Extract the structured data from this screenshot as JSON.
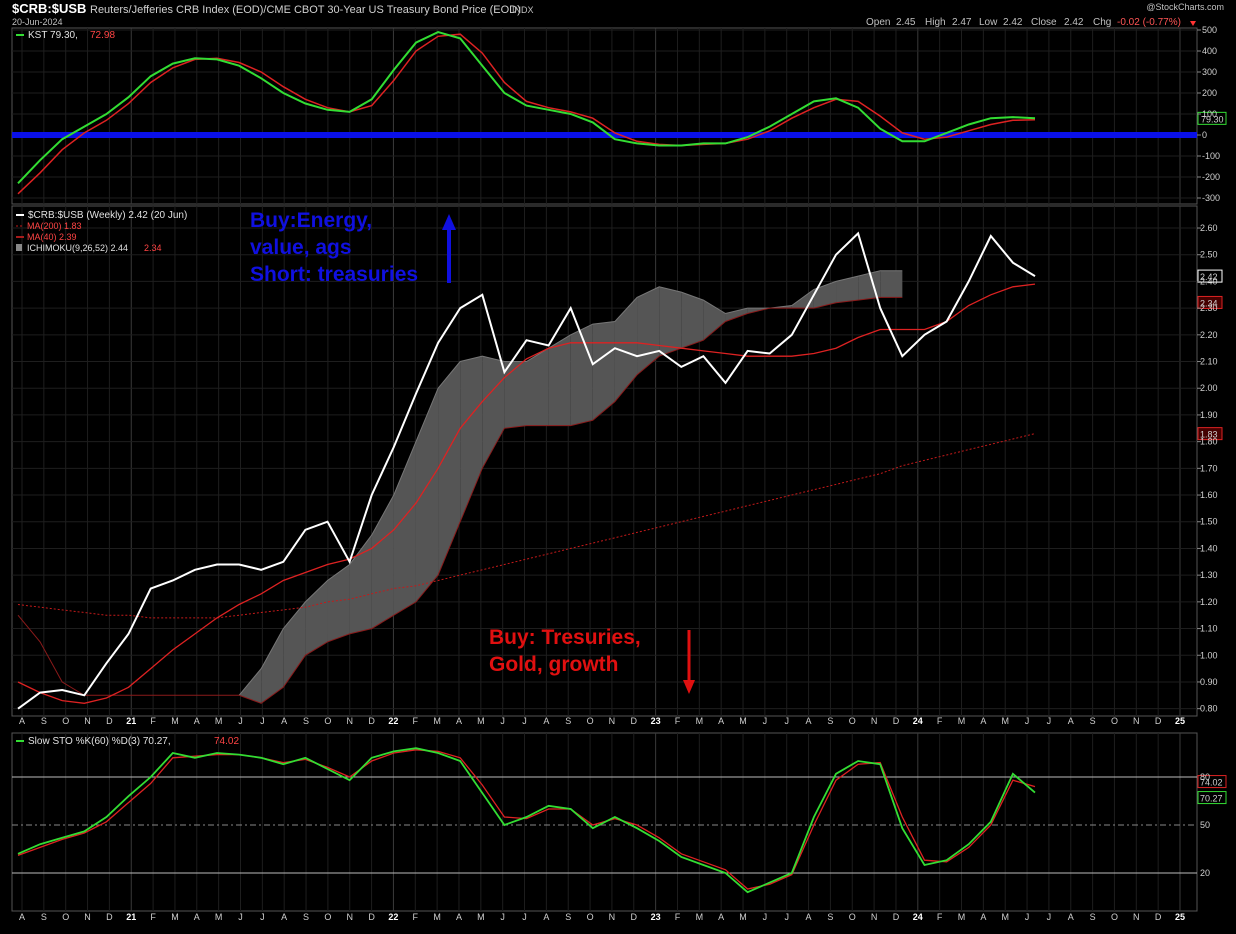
{
  "header": {
    "symbol": "$CRB:$USB",
    "description": "Reuters/Jefferies CRB Index (EOD)/CME CBOT 30-Year US Treasury Bond Price (EOD)",
    "exchange": "INDX",
    "date": "20-Jun-2024",
    "watermark": "@StockCharts.com",
    "open_label": "Open",
    "open": "2.45",
    "high_label": "High",
    "high": "2.47",
    "low_label": "Low",
    "low": "2.42",
    "close_label": "Close",
    "close": "2.42",
    "chg_label": "Chg",
    "chg": "-0.02 (-0.77%)"
  },
  "colors": {
    "background": "#000000",
    "price_line": "#ffffff",
    "kst_line": "#33dd33",
    "signal_line": "#dd2222",
    "zero_line": "#0a10e8",
    "cloud_bull": "#555555",
    "cloud_bear": "#5a0a0a",
    "annotation_blue": "#1010e0",
    "annotation_red": "#e01010"
  },
  "annotations": {
    "buy_energy": [
      "Buy:Energy,",
      "value, ags",
      "Short: treasuries"
    ],
    "buy_treasuries": [
      "Buy: Tresuries,",
      "Gold, growth"
    ]
  },
  "chart_data": [
    {
      "type": "line",
      "panel": "KST",
      "legend": [
        "KST 79.30,",
        "72.98"
      ],
      "last_labels": {
        "kst": "79.30"
      },
      "ylim": [
        -300,
        500
      ],
      "y_ticks": [
        "500",
        "400",
        "300",
        "200",
        "100",
        "0",
        "-100",
        "-200",
        "-300"
      ],
      "x": [
        "2020-08",
        "2020-09",
        "2020-10",
        "2020-11",
        "2020-12",
        "2021-01",
        "2021-02",
        "2021-03",
        "2021-04",
        "2021-05",
        "2021-06",
        "2021-07",
        "2021-08",
        "2021-09",
        "2021-10",
        "2021-11",
        "2021-12",
        "2022-01",
        "2022-02",
        "2022-03",
        "2022-04",
        "2022-05",
        "2022-06",
        "2022-07",
        "2022-08",
        "2022-09",
        "2022-10",
        "2022-11",
        "2022-12",
        "2023-01",
        "2023-02",
        "2023-03",
        "2023-04",
        "2023-05",
        "2023-06",
        "2023-07",
        "2023-08",
        "2023-09",
        "2023-10",
        "2023-11",
        "2023-12",
        "2024-01",
        "2024-02",
        "2024-03",
        "2024-04",
        "2024-05",
        "2024-06"
      ],
      "series": [
        {
          "name": "KST",
          "color": "#33dd33",
          "values": [
            -230,
            -120,
            -20,
            40,
            100,
            180,
            280,
            340,
            365,
            360,
            330,
            270,
            200,
            150,
            120,
            110,
            170,
            310,
            440,
            490,
            460,
            330,
            200,
            140,
            120,
            100,
            60,
            -20,
            -40,
            -50,
            -50,
            -40,
            -40,
            -10,
            40,
            100,
            160,
            175,
            130,
            30,
            -30,
            -30,
            10,
            50,
            80,
            85,
            79.3
          ]
        },
        {
          "name": "Signal",
          "color": "#dd2222",
          "values": [
            -280,
            -180,
            -70,
            10,
            70,
            150,
            250,
            320,
            360,
            365,
            345,
            300,
            230,
            170,
            130,
            110,
            140,
            260,
            400,
            470,
            480,
            390,
            250,
            160,
            130,
            110,
            80,
            10,
            -30,
            -45,
            -50,
            -45,
            -40,
            -20,
            20,
            80,
            130,
            170,
            160,
            90,
            10,
            -20,
            -10,
            20,
            50,
            70,
            72.98
          ]
        }
      ],
      "zero_line": 0
    },
    {
      "type": "line",
      "panel": "Price",
      "legend": [
        "$CRB:$USB (Weekly) 2.42 (20 Jun)",
        "MA(200) 1.83",
        "MA(40) 2.39",
        "ICHIMOKU(9,26,52) 2.44",
        "2.34"
      ],
      "last_labels": {
        "price": "2.42",
        "ichimoku": "2.44",
        "cloud": "2.34",
        "ma200": "1.83"
      },
      "ylim": [
        0.78,
        2.66
      ],
      "y_ticks": [
        "2.60",
        "2.50",
        "2.40",
        "2.30",
        "2.20",
        "2.10",
        "2.00",
        "1.90",
        "1.80",
        "1.70",
        "1.60",
        "1.50",
        "1.40",
        "1.30",
        "1.20",
        "1.10",
        "1.00",
        "0.90",
        "0.80"
      ],
      "x": [
        "2020-08",
        "2020-09",
        "2020-10",
        "2020-11",
        "2020-12",
        "2021-01",
        "2021-02",
        "2021-03",
        "2021-04",
        "2021-05",
        "2021-06",
        "2021-07",
        "2021-08",
        "2021-09",
        "2021-10",
        "2021-11",
        "2021-12",
        "2022-01",
        "2022-02",
        "2022-03",
        "2022-04",
        "2022-05",
        "2022-06",
        "2022-07",
        "2022-08",
        "2022-09",
        "2022-10",
        "2022-11",
        "2022-12",
        "2023-01",
        "2023-02",
        "2023-03",
        "2023-04",
        "2023-05",
        "2023-06",
        "2023-07",
        "2023-08",
        "2023-09",
        "2023-10",
        "2023-11",
        "2023-12",
        "2024-01",
        "2024-02",
        "2024-03",
        "2024-04",
        "2024-05",
        "2024-06"
      ],
      "series": [
        {
          "name": "$CRB:$USB",
          "color": "#ffffff",
          "values": [
            0.8,
            0.86,
            0.87,
            0.85,
            0.97,
            1.08,
            1.25,
            1.28,
            1.32,
            1.34,
            1.34,
            1.32,
            1.35,
            1.47,
            1.5,
            1.35,
            1.6,
            1.78,
            1.98,
            2.17,
            2.3,
            2.35,
            2.06,
            2.18,
            2.16,
            2.3,
            2.09,
            2.15,
            2.12,
            2.14,
            2.08,
            2.12,
            2.02,
            2.14,
            2.13,
            2.2,
            2.35,
            2.5,
            2.58,
            2.3,
            2.12,
            2.2,
            2.25,
            2.4,
            2.57,
            2.47,
            2.42
          ]
        },
        {
          "name": "MA(40)",
          "color": "#dd2222",
          "values": [
            0.9,
            0.86,
            0.83,
            0.82,
            0.84,
            0.88,
            0.95,
            1.02,
            1.08,
            1.14,
            1.19,
            1.23,
            1.28,
            1.31,
            1.34,
            1.36,
            1.4,
            1.47,
            1.57,
            1.7,
            1.85,
            1.95,
            2.04,
            2.11,
            2.15,
            2.17,
            2.17,
            2.17,
            2.17,
            2.16,
            2.15,
            2.14,
            2.13,
            2.12,
            2.12,
            2.12,
            2.13,
            2.15,
            2.19,
            2.22,
            2.22,
            2.22,
            2.25,
            2.31,
            2.35,
            2.38,
            2.39
          ]
        },
        {
          "name": "MA(200)",
          "color": "#c41a1a",
          "values": [
            1.19,
            1.18,
            1.17,
            1.16,
            1.15,
            1.15,
            1.14,
            1.14,
            1.14,
            1.14,
            1.15,
            1.16,
            1.17,
            1.18,
            1.2,
            1.21,
            1.23,
            1.25,
            1.26,
            1.28,
            1.3,
            1.32,
            1.34,
            1.36,
            1.38,
            1.4,
            1.42,
            1.44,
            1.46,
            1.48,
            1.5,
            1.52,
            1.54,
            1.56,
            1.58,
            1.6,
            1.62,
            1.64,
            1.66,
            1.68,
            1.71,
            1.73,
            1.75,
            1.77,
            1.79,
            1.81,
            1.83
          ]
        },
        {
          "name": "Cloud Span A",
          "color": "#777777",
          "values": [
            null,
            null,
            null,
            null,
            null,
            null,
            null,
            null,
            null,
            null,
            0.85,
            0.95,
            1.1,
            1.2,
            1.28,
            1.34,
            1.45,
            1.6,
            1.8,
            2.0,
            2.1,
            2.12,
            2.1,
            2.1,
            2.15,
            2.2,
            2.24,
            2.25,
            2.34,
            2.38,
            2.36,
            2.33,
            2.28,
            2.3,
            2.3,
            2.31,
            2.37,
            2.4,
            2.42,
            2.44,
            2.44
          ]
        },
        {
          "name": "Cloud Span B",
          "color": "#8a1a1a",
          "values": [
            1.15,
            1.05,
            0.9,
            0.85,
            0.85,
            0.85,
            0.85,
            0.85,
            0.85,
            0.85,
            0.85,
            0.82,
            0.88,
            1.0,
            1.05,
            1.08,
            1.1,
            1.15,
            1.2,
            1.3,
            1.5,
            1.7,
            1.85,
            1.86,
            1.86,
            1.86,
            1.88,
            1.95,
            2.05,
            2.12,
            2.15,
            2.18,
            2.25,
            2.28,
            2.3,
            2.3,
            2.3,
            2.32,
            2.33,
            2.34,
            2.34
          ]
        }
      ]
    },
    {
      "type": "line",
      "panel": "Slow STO",
      "legend": [
        "Slow STO %K(60) %D(3) 70.27,",
        "74.02"
      ],
      "last_labels": {
        "k": "70.27",
        "d": "74.02"
      },
      "ylim": [
        0,
        100
      ],
      "y_ticks": [
        "80",
        "50",
        "20"
      ],
      "x": [
        "2020-08",
        "2020-09",
        "2020-10",
        "2020-11",
        "2020-12",
        "2021-01",
        "2021-02",
        "2021-03",
        "2021-04",
        "2021-05",
        "2021-06",
        "2021-07",
        "2021-08",
        "2021-09",
        "2021-10",
        "2021-11",
        "2021-12",
        "2022-01",
        "2022-02",
        "2022-03",
        "2022-04",
        "2022-05",
        "2022-06",
        "2022-07",
        "2022-08",
        "2022-09",
        "2022-10",
        "2022-11",
        "2022-12",
        "2023-01",
        "2023-02",
        "2023-03",
        "2023-04",
        "2023-05",
        "2023-06",
        "2023-07",
        "2023-08",
        "2023-09",
        "2023-10",
        "2023-11",
        "2023-12",
        "2024-01",
        "2024-02",
        "2024-03",
        "2024-04",
        "2024-05",
        "2024-06"
      ],
      "series": [
        {
          "name": "%K",
          "color": "#33dd33",
          "values": [
            32,
            38,
            42,
            46,
            55,
            68,
            80,
            95,
            92,
            95,
            94,
            92,
            88,
            92,
            85,
            78,
            92,
            96,
            98,
            95,
            90,
            70,
            50,
            55,
            62,
            60,
            48,
            55,
            48,
            40,
            30,
            25,
            20,
            8,
            14,
            20,
            55,
            82,
            90,
            88,
            48,
            25,
            28,
            38,
            52,
            82,
            70.27
          ]
        },
        {
          "name": "%D",
          "color": "#dd2222",
          "values": [
            31,
            36,
            41,
            45,
            52,
            64,
            76,
            92,
            93,
            94,
            94,
            92,
            89,
            91,
            86,
            80,
            90,
            95,
            97,
            96,
            92,
            75,
            55,
            54,
            60,
            60,
            50,
            54,
            50,
            42,
            32,
            27,
            22,
            10,
            13,
            19,
            50,
            78,
            88,
            89,
            55,
            28,
            27,
            36,
            50,
            78,
            74.02
          ]
        }
      ],
      "ref_lines": [
        80,
        50,
        20
      ]
    }
  ],
  "x_axis": {
    "labels": [
      "A",
      "S",
      "O",
      "N",
      "D",
      "21",
      "F",
      "M",
      "A",
      "M",
      "J",
      "J",
      "A",
      "S",
      "O",
      "N",
      "D",
      "22",
      "F",
      "M",
      "A",
      "M",
      "J",
      "J",
      "A",
      "S",
      "O",
      "N",
      "D",
      "23",
      "F",
      "M",
      "A",
      "M",
      "J",
      "J",
      "A",
      "S",
      "O",
      "N",
      "D",
      "24",
      "F",
      "M",
      "A",
      "M",
      "J",
      "J",
      "A",
      "S",
      "O",
      "N",
      "D",
      "25"
    ]
  }
}
